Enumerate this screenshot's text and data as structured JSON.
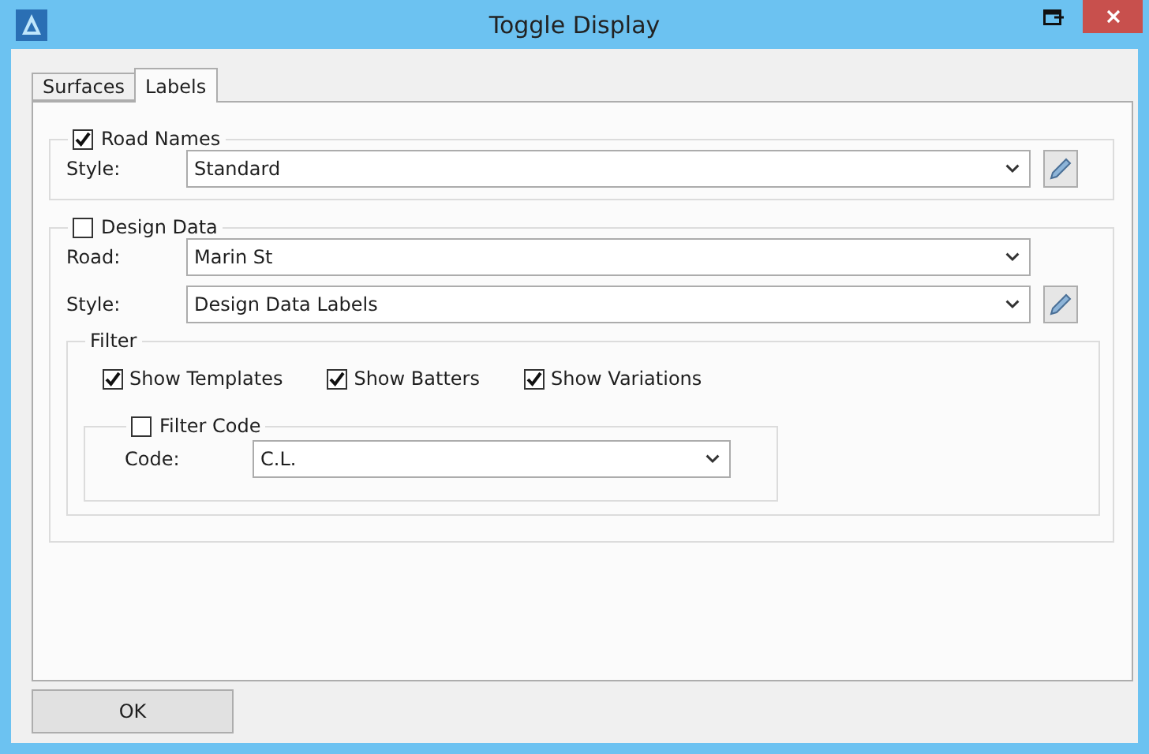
{
  "window": {
    "title": "Toggle Display"
  },
  "tabs": [
    {
      "label": "Surfaces",
      "selected": false
    },
    {
      "label": "Labels",
      "selected": true
    }
  ],
  "road_names": {
    "label": "Road Names",
    "checked": true,
    "style": {
      "label": "Style:",
      "value": "Standard"
    }
  },
  "design_data": {
    "label": "Design Data",
    "checked": false,
    "road": {
      "label": "Road:",
      "value": "Marin St"
    },
    "style": {
      "label": "Style:",
      "value": "Design Data Labels"
    },
    "filter": {
      "label": "Filter",
      "options": [
        {
          "label": "Show Templates",
          "checked": true
        },
        {
          "label": "Show Batters",
          "checked": true
        },
        {
          "label": "Show Variations",
          "checked": true
        }
      ],
      "filter_code": {
        "label": "Filter Code",
        "checked": false,
        "code": {
          "label": "Code:",
          "value": "C.L."
        }
      }
    }
  },
  "buttons": [
    "OK"
  ]
}
